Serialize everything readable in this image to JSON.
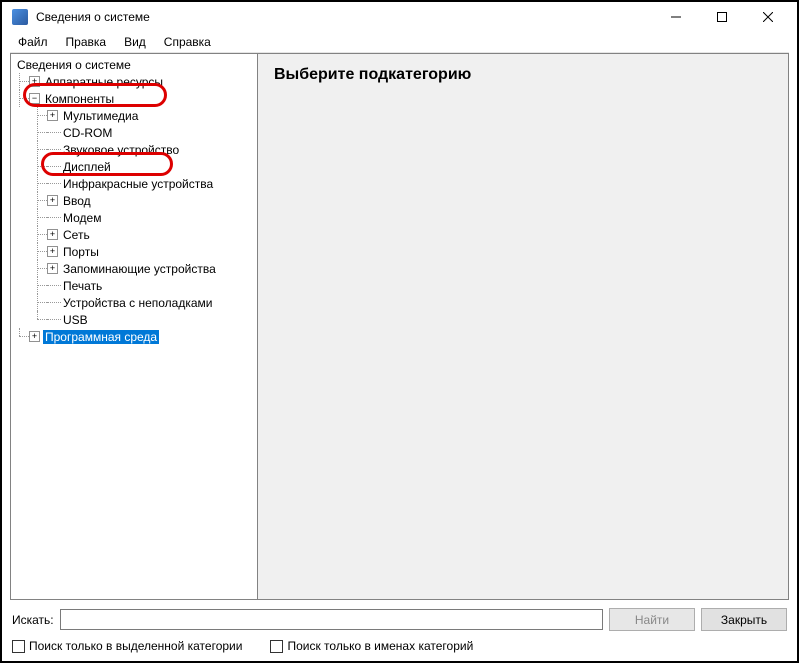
{
  "window": {
    "title": "Сведения о системе"
  },
  "menubar": {
    "file": "Файл",
    "edit": "Правка",
    "view": "Вид",
    "help": "Справка"
  },
  "tree": {
    "root": "Сведения о системе",
    "hardware_resources": "Аппаратные ресурсы",
    "components": "Компоненты",
    "multimedia": "Мультимедиа",
    "cdrom": "CD-ROM",
    "sound": "Звуковое устройство",
    "display": "Дисплей",
    "infrared": "Инфракрасные устройства",
    "input": "Ввод",
    "modem": "Модем",
    "network": "Сеть",
    "ports": "Порты",
    "storage": "Запоминающие устройства",
    "print": "Печать",
    "problem_devices": "Устройства с неполадками",
    "usb": "USB",
    "software_env": "Программная среда"
  },
  "main": {
    "heading": "Выберите подкатегорию"
  },
  "search": {
    "label": "Искать:",
    "placeholder": "",
    "find_btn": "Найти",
    "close_btn": "Закрыть"
  },
  "checks": {
    "only_selected": "Поиск только в выделенной категории",
    "only_names": "Поиск только в именах категорий"
  }
}
